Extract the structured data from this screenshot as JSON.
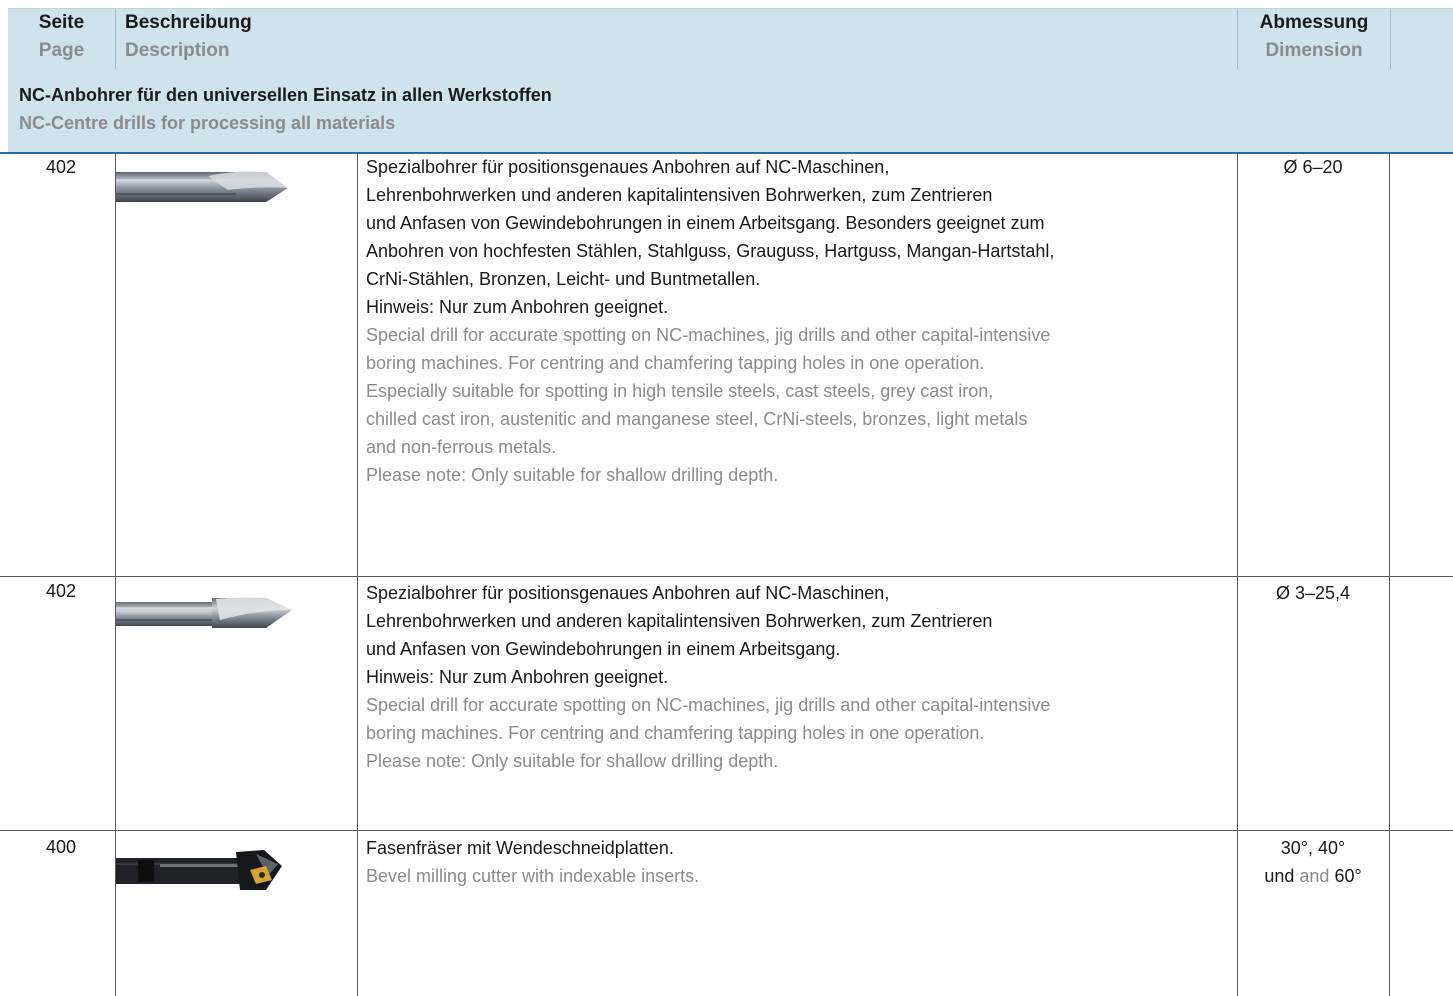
{
  "header": {
    "col_page_de": "Seite",
    "col_page_en": "Page",
    "col_desc_de": "Beschreibung",
    "col_desc_en": "Description",
    "col_dim_de": "Abmessung",
    "col_dim_en": "Dimension"
  },
  "section": {
    "title_de": "NC-Anbohrer für den universellen Einsatz in allen Werkstoffen",
    "title_en": "NC-Centre drills for processing all materials"
  },
  "rows": [
    {
      "page": "402",
      "image": "nc-spot-drill-icon",
      "desc_de": [
        "Spezialbohrer für positionsgenaues Anbohren auf NC-Maschinen,",
        "Lehrenbohrwerken und anderen kapitalintensiven Bohrwerken, zum Zentrieren",
        "und Anfasen von Gewindebohrungen in einem Arbeitsgang. Besonders geeignet zum",
        "Anbohren von hochfesten Stählen, Stahlguss, Grauguss, Hartguss, Mangan-Hartstahl,",
        "CrNi-Stählen, Bronzen, Leicht- und Buntmetallen.",
        "Hinweis: Nur zum Anbohren geeignet."
      ],
      "desc_en": [
        "Special drill for accurate spotting on NC-machines, jig drills and other capital-intensive",
        "boring machines. For centring and chamfering tapping holes in one operation.",
        "Especially suitable for spotting in high tensile steels, cast steels, grey cast iron,",
        "chilled cast iron, austenitic and manganese steel, CrNi-steels, bronzes, light metals",
        "and non-ferrous metals.",
        "Please note: Only suitable for shallow drilling depth."
      ],
      "dim": "Ø 6–20"
    },
    {
      "page": "402",
      "image": "nc-spot-drill-icon",
      "desc_de": [
        "Spezialbohrer für positionsgenaues Anbohren auf NC-Maschinen,",
        "Lehrenbohrwerken und anderen kapitalintensiven Bohrwerken, zum Zentrieren",
        "und Anfasen von Gewindebohrungen in einem Arbeitsgang.",
        "Hinweis: Nur zum Anbohren geeignet."
      ],
      "desc_en": [
        "Special drill for accurate spotting on NC-machines, jig drills and other capital-intensive",
        "boring machines. For centring and chamfering tapping holes in one operation.",
        "Please note: Only suitable for shallow drilling depth."
      ],
      "dim": "Ø 3–25,4"
    },
    {
      "page": "400",
      "image": "bevel-milling-cutter-icon",
      "desc_de": [
        "Fasenfräser mit Wendeschneidplatten."
      ],
      "desc_en": [
        "Bevel milling cutter with indexable inserts."
      ],
      "dim_line1": "30°, 40°",
      "dim_und": "und",
      "dim_and": "and",
      "dim_60": "60°"
    }
  ],
  "colors": {
    "header_bg": "#cfe3ed",
    "accent_line": "#2b6a9b",
    "english_text": "#8b8b8b"
  }
}
